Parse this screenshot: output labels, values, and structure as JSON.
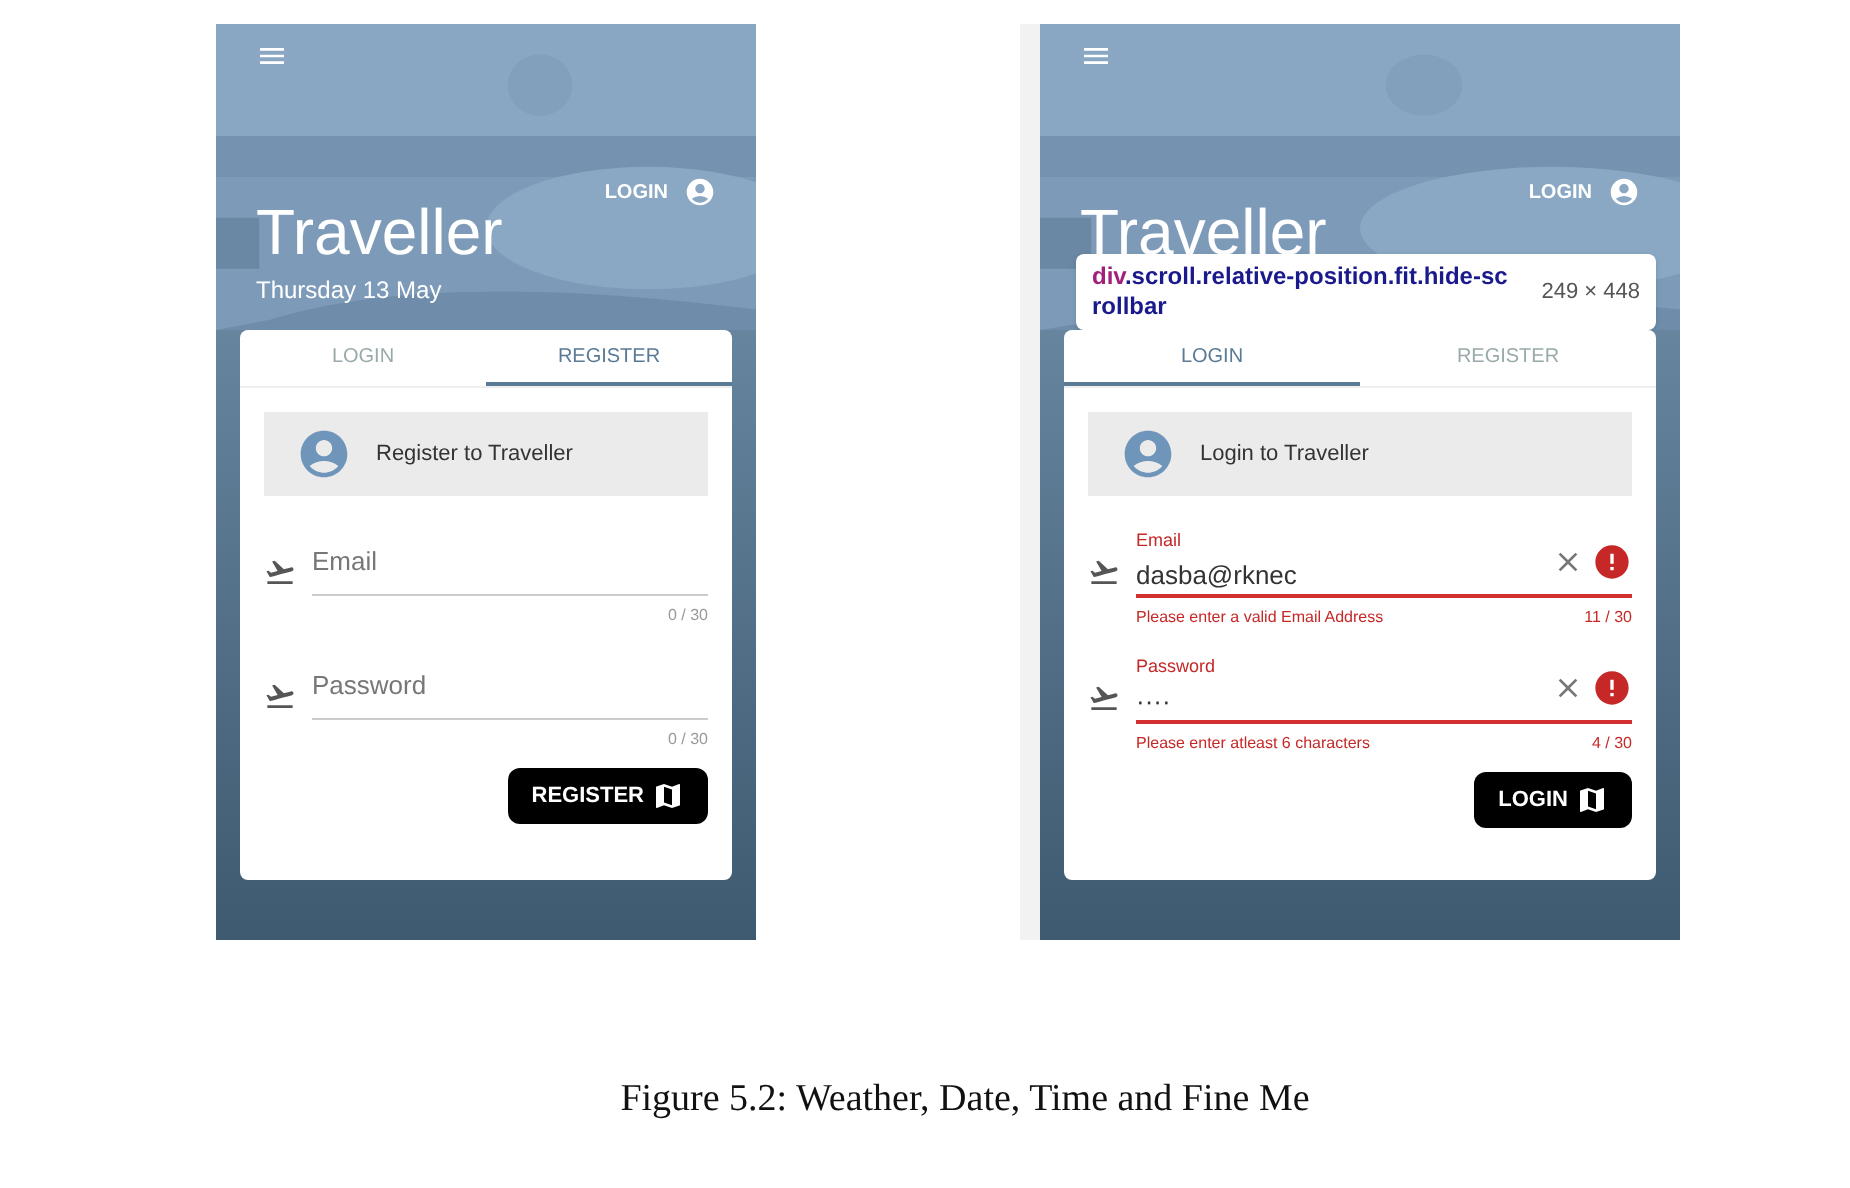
{
  "screens": [
    {
      "header": {
        "login": "LOGIN",
        "title": "Traveller",
        "date": "Thursday 13 May"
      },
      "tabs": [
        {
          "label": "LOGIN",
          "selected": false
        },
        {
          "label": "REGISTER",
          "selected": true
        }
      ],
      "banner": "Register to Traveller",
      "fields": [
        {
          "placeholder": "Email",
          "counter": "0 / 30",
          "invalid": false
        },
        {
          "placeholder": "Password",
          "counter": "0 / 30",
          "invalid": false
        }
      ],
      "button": "REGISTER"
    },
    {
      "header": {
        "login": "LOGIN",
        "title": "Traveller"
      },
      "inspector": {
        "tag": "div",
        "selector": ".scroll.relative-position.fit.hide-scrollbar",
        "size": "249 × 448"
      },
      "tabs": [
        {
          "label": "LOGIN",
          "selected": true
        },
        {
          "label": "REGISTER",
          "selected": false
        }
      ],
      "banner": "Login to Traveller",
      "fields": [
        {
          "label": "Email",
          "value": "dasba@rknec",
          "error": "Please enter a valid Email Address",
          "counter": "11 / 30",
          "invalid": true
        },
        {
          "label": "Password",
          "value": "····",
          "error": "Please enter atleast 6 characters",
          "counter": "4 / 30",
          "invalid": true
        }
      ],
      "button": "LOGIN"
    }
  ],
  "caption": "Figure 5.2: Weather, Date, Time and Fine Me"
}
